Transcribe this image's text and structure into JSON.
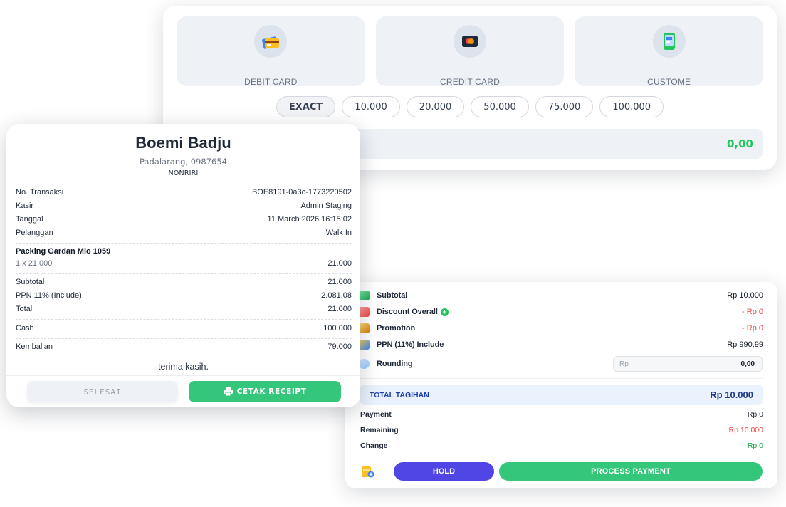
{
  "payment_methods": [
    {
      "label": "DEBIT CARD",
      "icon": "debit-card-icon"
    },
    {
      "label": "CREDIT CARD",
      "icon": "credit-card-icon"
    },
    {
      "label": "CUSTOME",
      "icon": "phone-payment-icon"
    }
  ],
  "quick_amounts": [
    "EXACT",
    "10.000",
    "20.000",
    "50.000",
    "75.000",
    "100.000"
  ],
  "payment_input": {
    "value": "0,00"
  },
  "summary": {
    "subtotal_label": "Subtotal",
    "subtotal_value": "Rp 10.000",
    "discount_label": "Discount Overall",
    "discount_value": "- Rp 0",
    "promotion_label": "Promotion",
    "promotion_value": "- Rp 0",
    "ppn_label": "PPN (11%) Include",
    "ppn_value": "Rp 990,99",
    "rounding_label": "Rounding",
    "rounding_prefix": "Rp",
    "rounding_value": "0,00",
    "total_label": "TOTAL TAGIHAN",
    "total_value": "Rp 10.000",
    "payment_label": "Payment",
    "payment_value": "Rp 0",
    "remaining_label": "Remaining",
    "remaining_value": "Rp 10.000",
    "change_label": "Change",
    "change_value": "Rp 0",
    "hold_label": "HOLD",
    "process_label": "PROCESS PAYMENT"
  },
  "receipt": {
    "store_name": "Boemi Badju",
    "address": "Padalarang, 0987654",
    "code": "NONRIRI",
    "meta": [
      {
        "k": "No. Transaksi",
        "v": "BOE8191-0a3c-1773220502"
      },
      {
        "k": "Kasir",
        "v": "Admin Staging"
      },
      {
        "k": "Tanggal",
        "v": "11 March 2026 16:15:02"
      },
      {
        "k": "Pelanggan",
        "v": "Walk In"
      }
    ],
    "item": {
      "name": "Packing Gardan Mio 1059",
      "qty": "1 x 21.000",
      "price": "21.000"
    },
    "totals": [
      {
        "k": "Subtotal",
        "v": "21.000"
      },
      {
        "k": "PPN 11% (Include)",
        "v": "2.081,08"
      },
      {
        "k": "Total",
        "v": "21.000"
      }
    ],
    "cash": {
      "k": "Cash",
      "v": "100.000"
    },
    "change": {
      "k": "Kembalian",
      "v": "79.000"
    },
    "thanks": "terima kasih.",
    "done_label": "SELESAI",
    "print_label": "CETAK RECEIPT"
  },
  "colors": {
    "accent_green": "#34c77b",
    "accent_indigo": "#4f46e5",
    "total_blue": "#1e3a8a",
    "negative": "#ef4444"
  }
}
